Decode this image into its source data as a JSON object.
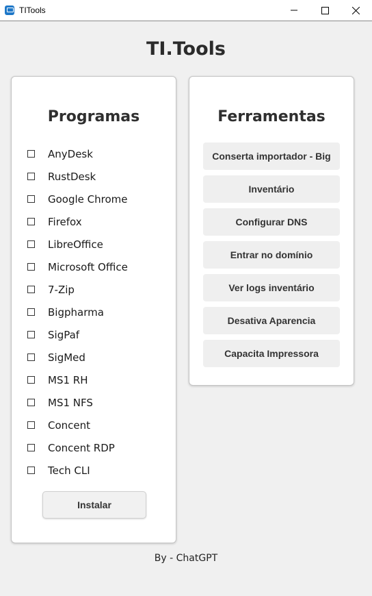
{
  "window": {
    "title": "TITools",
    "icon": "monitor-app-icon"
  },
  "app_title": "TI.Tools",
  "programs": {
    "title": "Programas",
    "items": [
      {
        "label": "AnyDesk",
        "checked": false
      },
      {
        "label": "RustDesk",
        "checked": false
      },
      {
        "label": "Google Chrome",
        "checked": false
      },
      {
        "label": "Firefox",
        "checked": false
      },
      {
        "label": "LibreOffice",
        "checked": false
      },
      {
        "label": "Microsoft Office",
        "checked": false
      },
      {
        "label": "7-Zip",
        "checked": false
      },
      {
        "label": "Bigpharma",
        "checked": false
      },
      {
        "label": "SigPaf",
        "checked": false
      },
      {
        "label": "SigMed",
        "checked": false
      },
      {
        "label": "MS1 RH",
        "checked": false
      },
      {
        "label": "MS1 NFS",
        "checked": false
      },
      {
        "label": "Concent",
        "checked": false
      },
      {
        "label": "Concent RDP",
        "checked": false
      },
      {
        "label": "Tech CLI",
        "checked": false
      }
    ],
    "install_label": "Instalar"
  },
  "tools": {
    "title": "Ferramentas",
    "buttons": [
      "Conserta importador - Big",
      "Inventário",
      "Configurar DNS",
      "Entrar no domínio",
      "Ver logs inventário",
      "Desativa Aparencia",
      "Capacita Impressora"
    ]
  },
  "footer": "By - ChatGPT",
  "colors": {
    "background": "#f0f0f0",
    "card": "#ffffff",
    "button": "#efefef",
    "text": "#2b2b2b"
  }
}
